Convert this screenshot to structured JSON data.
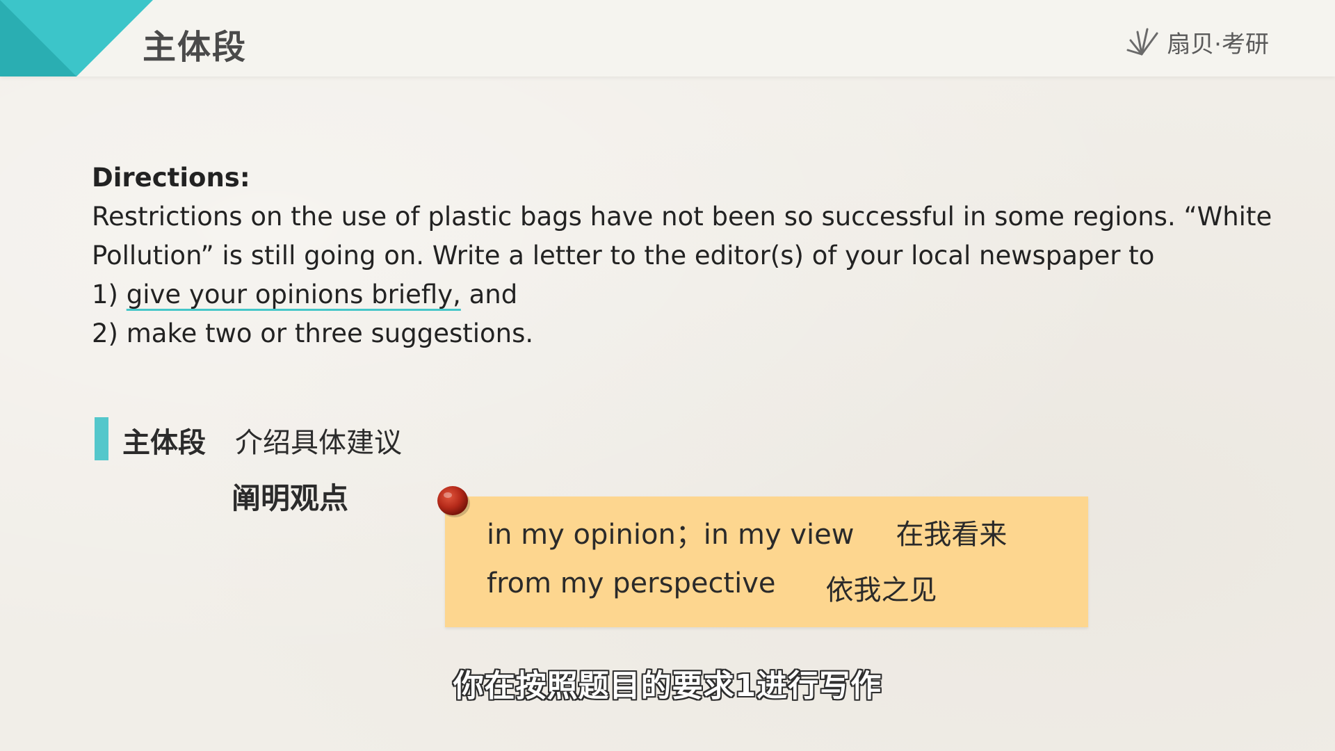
{
  "header": {
    "title": "主体段",
    "logo_text": "扇贝·考研",
    "accent_color": "#3cc5c9"
  },
  "directions": {
    "heading": "Directions:",
    "paragraph": "Restrictions on the use of plastic bags have not been so successful in some regions. “White Pollution” is still going on. Write a letter to the editor(s) of your local newspaper to",
    "item1_prefix": "1) ",
    "item1_underlined": "give your opinions briefly,",
    "item1_suffix": " and",
    "item2": "2) make two or three suggestions."
  },
  "section": {
    "title": "主体段",
    "subtitle": "介绍具体建议",
    "point_title": "阐明观点"
  },
  "phrases": [
    {
      "en": "in my opinion；in my view",
      "zh": "在我看来"
    },
    {
      "en": "from my perspective",
      "zh": "依我之见"
    }
  ],
  "caption": "你在按照题目的要求1进行写作"
}
